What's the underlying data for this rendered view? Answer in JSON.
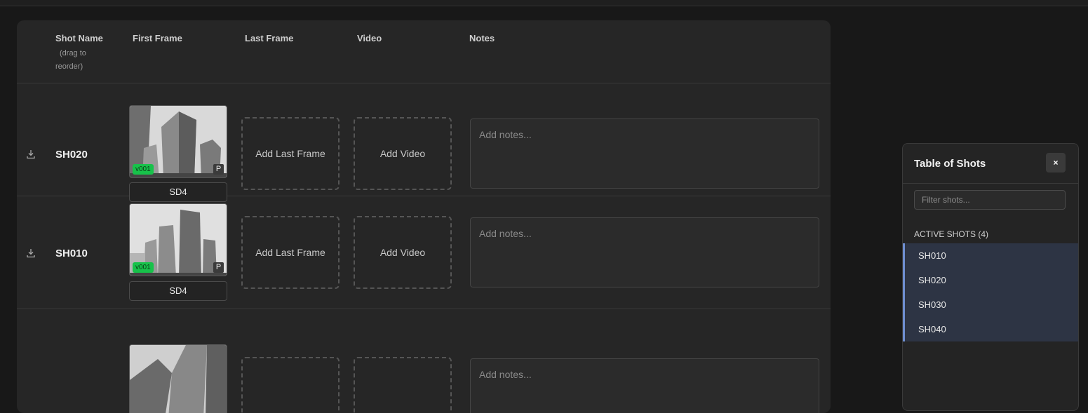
{
  "table": {
    "headers": {
      "shot_name": "Shot Name",
      "shot_name_sub": [
        "(drag to",
        "reorder)"
      ],
      "first_frame": "First Frame",
      "last_frame": "Last Frame",
      "video": "Video",
      "notes": "Notes"
    },
    "rows": [
      {
        "name": "SH020",
        "version": "v001",
        "p_badge": "P",
        "model": "SD4",
        "last_frame": "Add Last Frame",
        "video": "Add Video",
        "notes_placeholder": "Add notes..."
      },
      {
        "name": "SH010",
        "version": "v001",
        "p_badge": "P",
        "model": "SD4",
        "last_frame": "Add Last Frame",
        "video": "Add Video",
        "notes_placeholder": "Add notes..."
      },
      {
        "name": "",
        "version": "",
        "p_badge": "",
        "model": "",
        "last_frame": "",
        "video": "",
        "notes_placeholder": "Add notes..."
      }
    ]
  },
  "toc": {
    "title": "Table of Shots",
    "close_label": "×",
    "filter_placeholder": "Filter shots...",
    "section_label": "ACTIVE SHOTS (4)",
    "items": [
      "SH010",
      "SH020",
      "SH030",
      "SH040"
    ]
  },
  "colors": {
    "background": "#181818",
    "panel": "#262626",
    "version_badge": "#17c24a",
    "toc_active": "#2d3444",
    "toc_accent": "#6f8fd1"
  }
}
